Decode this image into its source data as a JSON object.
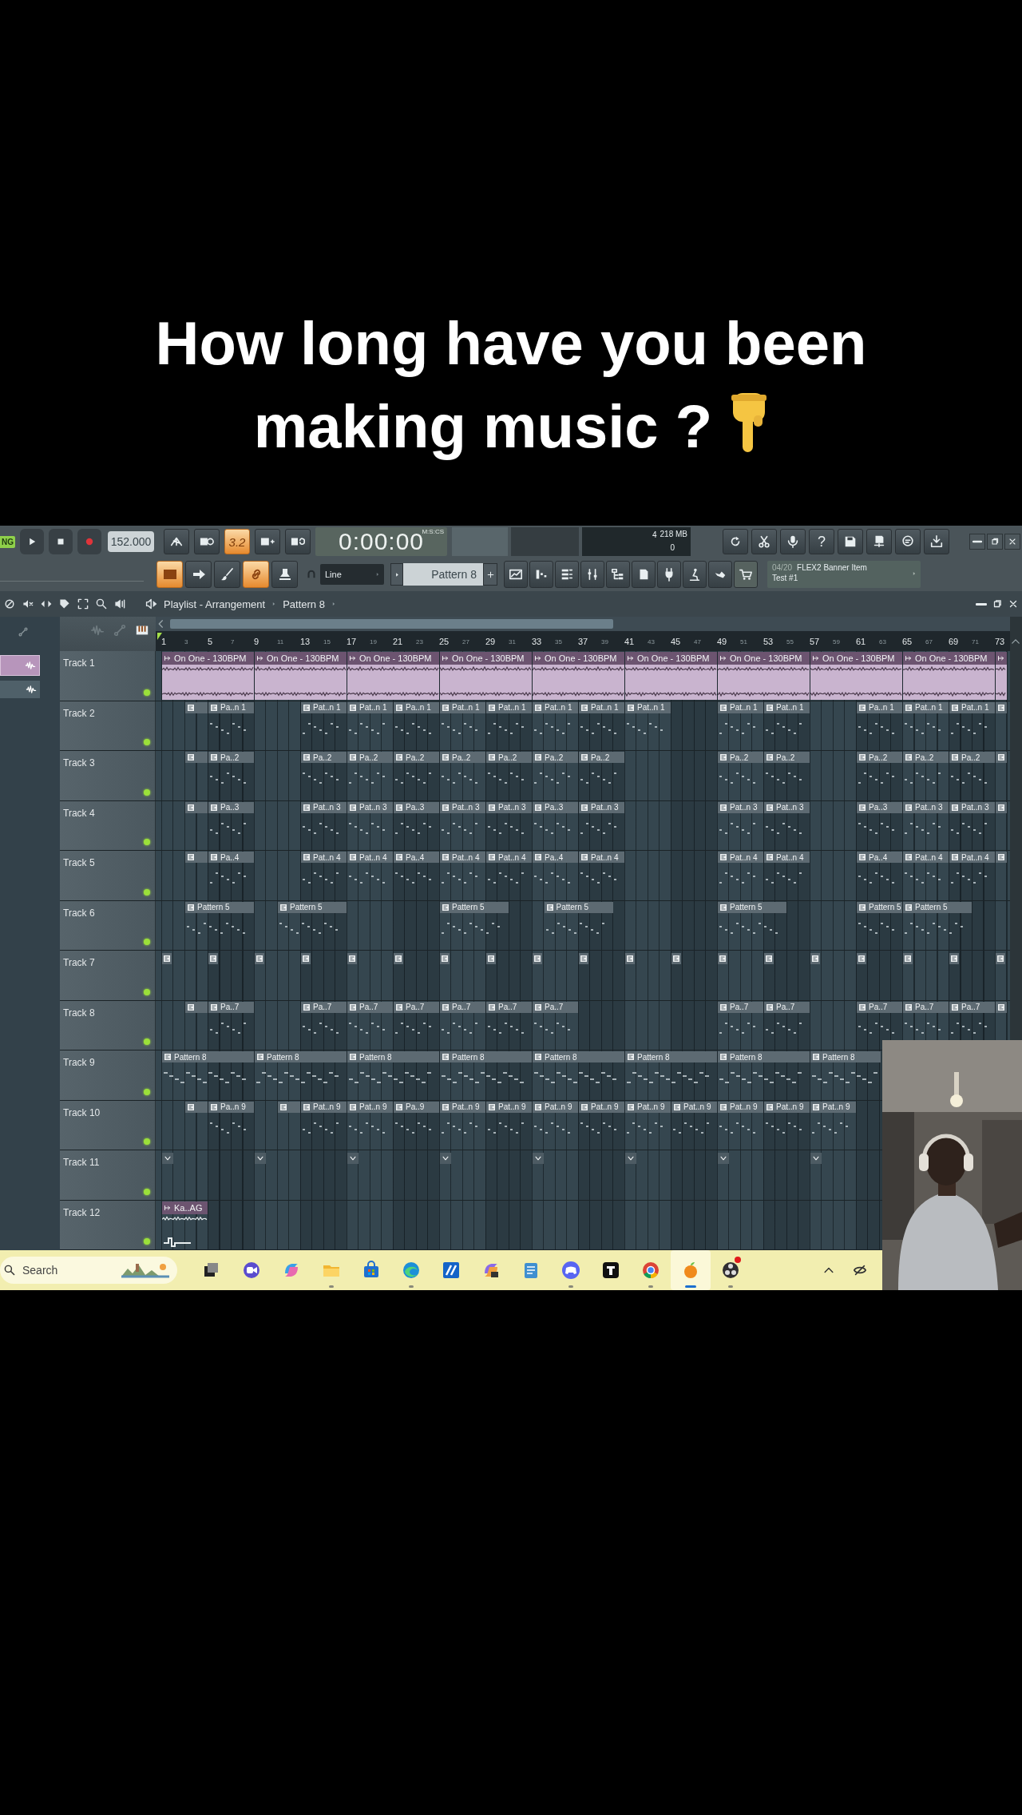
{
  "caption": {
    "lines": [
      "How long have you been",
      "making music ?"
    ]
  },
  "toolbar": {
    "mode_label": "NG",
    "tempo": "152.000",
    "buttons_top": [
      {
        "kind": "metronome",
        "on": false
      },
      {
        "kind": "wait",
        "on": false
      },
      {
        "kind": "countdown",
        "label": "3.2",
        "on": true
      },
      {
        "kind": "step",
        "on": false
      },
      {
        "kind": "loop",
        "on": false
      }
    ],
    "time": "0:00:00",
    "time_unit": "M:S:CS",
    "cpu": "4",
    "memory": "218 MB",
    "polyphony": "0",
    "tools": [
      {
        "kind": "refresh"
      },
      {
        "kind": "cut"
      },
      {
        "kind": "mic"
      },
      {
        "kind": "help",
        "label": "?"
      },
      {
        "kind": "save"
      },
      {
        "kind": "saveas"
      },
      {
        "kind": "chat"
      },
      {
        "kind": "download"
      }
    ],
    "buttons_bottom": [
      {
        "kind": "piano",
        "on": true
      },
      {
        "kind": "arrow",
        "on": false
      },
      {
        "kind": "brush",
        "on": false
      },
      {
        "kind": "link",
        "on": true
      },
      {
        "kind": "stamp",
        "on": false
      }
    ],
    "snap": "Line",
    "pattern": "Pattern 8",
    "news_date": "04/20",
    "news_title": "FLEX2 Banner Item",
    "news_subtitle": "Test #1"
  },
  "playlist": {
    "title": "Playlist - Arrangement",
    "breadcrumb": "Pattern 8",
    "ruler": [
      "1",
      "3",
      "5",
      "7",
      "9",
      "11",
      "13",
      "15",
      "17",
      "19",
      "21",
      "23",
      "25",
      "27",
      "29",
      "31",
      "33",
      "35",
      "37",
      "39",
      "41",
      "43",
      "45",
      "47",
      "49",
      "51",
      "53",
      "55",
      "57",
      "59",
      "61",
      "63",
      "65",
      "67",
      "69",
      "71",
      "73"
    ],
    "tracks": [
      {
        "name": "Track 1",
        "clips": [
          {
            "kind": "audio",
            "label": "On One - 130BPM",
            "color": "#c9b4cf"
          },
          {
            "kind": "audio",
            "label": "On One - 130BPM",
            "color": "#c9b4cf"
          },
          {
            "kind": "audio",
            "label": "On One - 130BPM",
            "color": "#c9b4cf"
          },
          {
            "kind": "audio",
            "label": "On One - 130BPM",
            "color": "#c9b4cf"
          },
          {
            "kind": "audio",
            "label": "On One - 130BPM",
            "color": "#c9b4cf"
          },
          {
            "kind": "audio",
            "label": "On One - 130BPM",
            "color": "#c9b4cf"
          },
          {
            "kind": "audio",
            "label": "On One - 130BPM",
            "color": "#c9b4cf"
          },
          {
            "kind": "audio",
            "label": "On One - 130BPM",
            "color": "#c9b4cf"
          },
          {
            "kind": "audio",
            "label": "On One - 130BPM",
            "color": "#c9b4cf"
          },
          {
            "kind": "audio",
            "color": "#c9b4cf"
          }
        ]
      },
      {
        "name": "Track 2",
        "clips": [
          {
            "kind": "pattern"
          },
          {
            "kind": "pattern",
            "label": "Pa..n 1"
          },
          {
            "kind": "pattern",
            "label": "Pat..n 1"
          },
          {
            "kind": "pattern",
            "label": "Pat..n 1"
          },
          {
            "kind": "pattern",
            "label": "Pa..n 1"
          },
          {
            "kind": "pattern",
            "label": "Pat..n 1"
          },
          {
            "kind": "pattern",
            "label": "Pat..n 1"
          },
          {
            "kind": "pattern",
            "label": "Pat..n 1"
          },
          {
            "kind": "pattern",
            "label": "Pat..n 1"
          },
          {
            "kind": "pattern",
            "label": "Pat..n 1"
          },
          {
            "kind": "pattern",
            "label": "Pat..n 1"
          },
          {
            "kind": "pattern",
            "label": "Pat..n 1"
          },
          {
            "kind": "pattern",
            "label": "Pa..n 1"
          },
          {
            "kind": "pattern",
            "label": "Pat..n 1"
          },
          {
            "kind": "pattern",
            "label": "Pat..n 1"
          },
          {
            "kind": "pattern"
          }
        ]
      },
      {
        "name": "Track 3",
        "clips": [
          {
            "kind": "pattern"
          },
          {
            "kind": "pattern",
            "label": "Pa..2"
          },
          {
            "kind": "pattern",
            "label": "Pa..2"
          },
          {
            "kind": "pattern",
            "label": "Pa..2"
          },
          {
            "kind": "pattern",
            "label": "Pa..2"
          },
          {
            "kind": "pattern",
            "label": "Pa..2"
          },
          {
            "kind": "pattern",
            "label": "Pa..2"
          },
          {
            "kind": "pattern",
            "label": "Pa..2"
          },
          {
            "kind": "pattern",
            "label": "Pa..2"
          },
          {
            "kind": "pattern",
            "label": "Pa..2"
          },
          {
            "kind": "pattern",
            "label": "Pa..2"
          },
          {
            "kind": "pattern",
            "label": "Pa..2"
          },
          {
            "kind": "pattern",
            "label": "Pa..2"
          },
          {
            "kind": "pattern",
            "label": "Pa..2"
          },
          {
            "kind": "pattern"
          }
        ]
      },
      {
        "name": "Track 4",
        "clips": [
          {
            "kind": "pattern"
          },
          {
            "kind": "pattern",
            "label": "Pa..3"
          },
          {
            "kind": "pattern",
            "label": "Pat..n 3"
          },
          {
            "kind": "pattern",
            "label": "Pat..n 3"
          },
          {
            "kind": "pattern",
            "label": "Pa..3"
          },
          {
            "kind": "pattern",
            "label": "Pat..n 3"
          },
          {
            "kind": "pattern",
            "label": "Pat..n 3"
          },
          {
            "kind": "pattern",
            "label": "Pa..3"
          },
          {
            "kind": "pattern",
            "label": "Pat..n 3"
          },
          {
            "kind": "pattern",
            "label": "Pat..n 3"
          },
          {
            "kind": "pattern",
            "label": "Pat..n 3"
          },
          {
            "kind": "pattern",
            "label": "Pa..3"
          },
          {
            "kind": "pattern",
            "label": "Pat..n 3"
          },
          {
            "kind": "pattern",
            "label": "Pat..n 3"
          },
          {
            "kind": "pattern"
          }
        ]
      },
      {
        "name": "Track 5",
        "clips": [
          {
            "kind": "pattern"
          },
          {
            "kind": "pattern",
            "label": "Pa..4"
          },
          {
            "kind": "pattern",
            "label": "Pat..n 4"
          },
          {
            "kind": "pattern",
            "label": "Pat..n 4"
          },
          {
            "kind": "pattern",
            "label": "Pa..4"
          },
          {
            "kind": "pattern",
            "label": "Pat..n 4"
          },
          {
            "kind": "pattern",
            "label": "Pat..n 4"
          },
          {
            "kind": "pattern",
            "label": "Pa..4"
          },
          {
            "kind": "pattern",
            "label": "Pat..n 4"
          },
          {
            "kind": "pattern",
            "label": "Pat..n 4"
          },
          {
            "kind": "pattern",
            "label": "Pat..n 4"
          },
          {
            "kind": "pattern",
            "label": "Pa..4"
          },
          {
            "kind": "pattern",
            "label": "Pat..n 4"
          },
          {
            "kind": "pattern",
            "label": "Pat..n 4"
          },
          {
            "kind": "pattern"
          }
        ]
      },
      {
        "name": "Track 6",
        "clips": [
          {
            "kind": "pattern",
            "label": "Pattern 5"
          },
          {
            "kind": "pattern",
            "label": "Pattern 5"
          },
          {
            "kind": "pattern",
            "label": "Pattern 5"
          },
          {
            "kind": "pattern",
            "label": "Pattern 5"
          },
          {
            "kind": "pattern",
            "label": "Pattern 5"
          },
          {
            "kind": "pattern",
            "label": "Pattern 5"
          },
          {
            "kind": "pattern",
            "label": "Pattern 5"
          }
        ]
      },
      {
        "name": "Track 7",
        "clips": [
          {
            "kind": "marker"
          },
          {
            "kind": "marker"
          },
          {
            "kind": "marker"
          },
          {
            "kind": "marker"
          },
          {
            "kind": "marker"
          },
          {
            "kind": "marker"
          },
          {
            "kind": "marker"
          },
          {
            "kind": "marker"
          },
          {
            "kind": "marker"
          },
          {
            "kind": "marker"
          },
          {
            "kind": "marker"
          },
          {
            "kind": "marker"
          },
          {
            "kind": "marker"
          },
          {
            "kind": "marker"
          },
          {
            "kind": "marker"
          },
          {
            "kind": "marker"
          },
          {
            "kind": "marker"
          },
          {
            "kind": "marker"
          },
          {
            "kind": "marker"
          }
        ]
      },
      {
        "name": "Track 8",
        "clips": [
          {
            "kind": "pattern"
          },
          {
            "kind": "pattern",
            "label": "Pa..7"
          },
          {
            "kind": "pattern",
            "label": "Pa..7"
          },
          {
            "kind": "pattern",
            "label": "Pa..7"
          },
          {
            "kind": "pattern",
            "label": "Pa..7"
          },
          {
            "kind": "pattern",
            "label": "Pa..7"
          },
          {
            "kind": "pattern",
            "label": "Pa..7"
          },
          {
            "kind": "pattern",
            "label": "Pa..7"
          },
          {
            "kind": "pattern",
            "label": "Pa..7"
          },
          {
            "kind": "pattern",
            "label": "Pa..7"
          },
          {
            "kind": "pattern",
            "label": "Pa..7"
          },
          {
            "kind": "pattern",
            "label": "Pa..7"
          },
          {
            "kind": "pattern",
            "label": "Pa..7"
          },
          {
            "kind": "pattern"
          }
        ]
      },
      {
        "name": "Track 9",
        "clips": [
          {
            "kind": "pattern",
            "label": "Pattern 8"
          },
          {
            "kind": "pattern",
            "label": "Pattern 8"
          },
          {
            "kind": "pattern",
            "label": "Pattern 8"
          },
          {
            "kind": "pattern",
            "label": "Pattern 8"
          },
          {
            "kind": "pattern",
            "label": "Pattern 8"
          },
          {
            "kind": "pattern",
            "label": "Pattern 8"
          },
          {
            "kind": "pattern",
            "label": "Pattern 8"
          },
          {
            "kind": "pattern",
            "label": "Pattern 8"
          }
        ]
      },
      {
        "name": "Track 10",
        "clips": [
          {
            "kind": "pattern"
          },
          {
            "kind": "pattern",
            "label": "Pa..n 9"
          },
          {
            "kind": "pattern"
          },
          {
            "kind": "pattern",
            "label": "Pat..n 9"
          },
          {
            "kind": "pattern",
            "label": "Pat..n 9"
          },
          {
            "kind": "pattern",
            "label": "Pa..9"
          },
          {
            "kind": "pattern",
            "label": "Pat..n 9"
          },
          {
            "kind": "pattern",
            "label": "Pat..n 9"
          },
          {
            "kind": "pattern",
            "label": "Pat..n 9"
          },
          {
            "kind": "pattern",
            "label": "Pat..n 9"
          },
          {
            "kind": "pattern",
            "label": "Pat..n 9"
          },
          {
            "kind": "pattern",
            "label": "Pat..n 9"
          },
          {
            "kind": "pattern",
            "label": "Pat..n 9"
          },
          {
            "kind": "pattern",
            "label": "Pat..n 9"
          },
          {
            "kind": "pattern",
            "label": "Pat..n 9"
          }
        ]
      },
      {
        "name": "Track 11",
        "clips": [
          {
            "kind": "automation"
          },
          {
            "kind": "automation"
          },
          {
            "kind": "automation"
          },
          {
            "kind": "automation"
          },
          {
            "kind": "automation"
          },
          {
            "kind": "automation"
          },
          {
            "kind": "automation"
          },
          {
            "kind": "automation"
          }
        ]
      },
      {
        "name": "Track 12",
        "clips": [
          {
            "kind": "audio",
            "label": "Ka..AG"
          }
        ]
      }
    ]
  },
  "taskbar": {
    "search_placeholder": "Search",
    "apps": [
      {
        "running": false,
        "badge": false
      },
      {
        "running": false,
        "badge": false
      },
      {
        "running": false,
        "badge": false
      },
      {
        "running": true,
        "badge": false
      },
      {
        "running": false,
        "badge": false
      },
      {
        "running": true,
        "badge": false
      },
      {
        "running": false,
        "badge": false
      },
      {
        "running": false,
        "badge": false
      },
      {
        "running": false,
        "badge": false
      },
      {
        "running": true,
        "badge": false
      },
      {
        "running": false,
        "badge": false
      },
      {
        "running": true,
        "badge": false
      },
      {
        "running": true,
        "badge": false
      },
      {
        "running": true,
        "badge": true
      }
    ]
  }
}
